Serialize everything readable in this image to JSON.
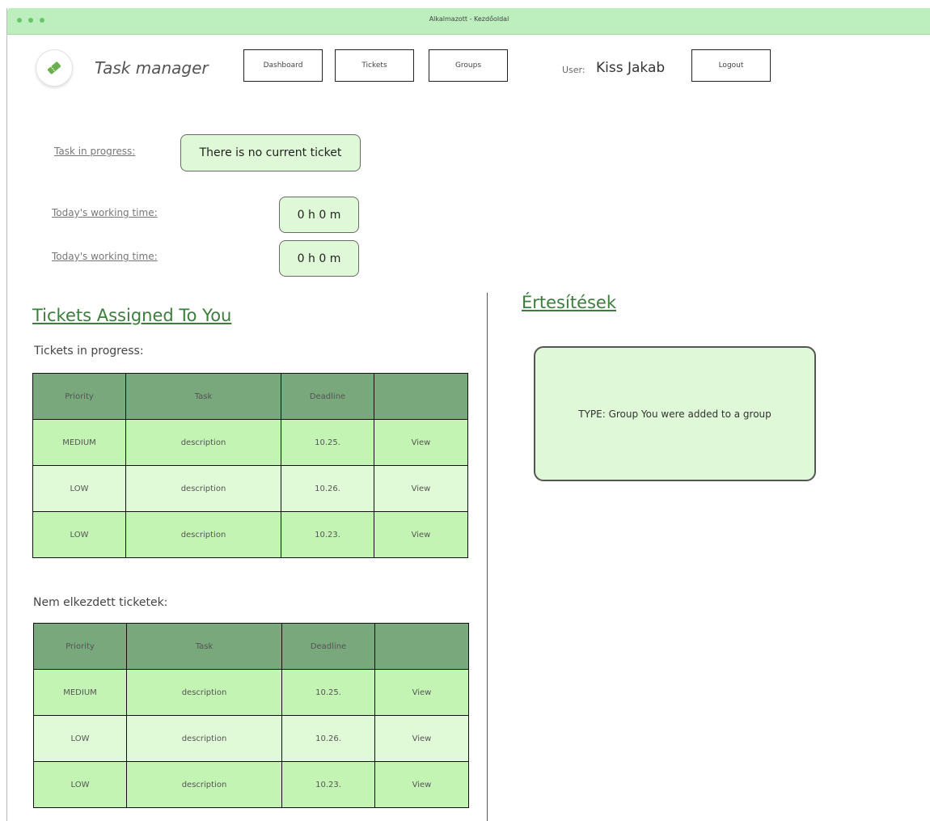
{
  "window": {
    "title": "Alkalmazott - Kezdőoldal"
  },
  "header": {
    "app_title": "Task manager",
    "nav": {
      "dashboard": "Dashboard",
      "tickets": "Tickets",
      "groups": "Groups"
    },
    "user_label": "User:",
    "user_name": "Kiss Jakab",
    "logout": "Logout"
  },
  "status": {
    "task_in_progress_label": "Task in progress:",
    "task_in_progress_value": "There is no current ticket",
    "working_time_1_label": "Today's working time:",
    "working_time_1_value": "0 h 0 m",
    "working_time_2_label": "Today's working time:",
    "working_time_2_value": "0 h 0 m"
  },
  "tickets_section": {
    "heading": "Tickets Assigned To You",
    "in_progress": {
      "label": "Tickets in progress:",
      "columns": [
        "Priority",
        "Task",
        "Deadline",
        ""
      ],
      "rows": [
        {
          "priority": "MEDIUM",
          "task": "description",
          "deadline": "10.25.",
          "action": "View"
        },
        {
          "priority": "LOW",
          "task": "description",
          "deadline": "10.26.",
          "action": "View"
        },
        {
          "priority": "LOW",
          "task": "description",
          "deadline": "10.23.",
          "action": "View"
        }
      ]
    },
    "not_started": {
      "label": "Nem elkezdett ticketek:",
      "columns": [
        "Priority",
        "Task",
        "Deadline",
        ""
      ],
      "rows": [
        {
          "priority": "MEDIUM",
          "task": "description",
          "deadline": "10.25.",
          "action": "View"
        },
        {
          "priority": "LOW",
          "task": "description",
          "deadline": "10.26.",
          "action": "View"
        },
        {
          "priority": "LOW",
          "task": "description",
          "deadline": "10.23.",
          "action": "View"
        }
      ]
    }
  },
  "notifications": {
    "heading": "Értesítések",
    "items": [
      {
        "text": "TYPE: Group You were added to a group"
      }
    ]
  },
  "colors": {
    "titlebar": "#bdeebd",
    "table_header": "#78a87b",
    "row_dark": "#c3f4b4",
    "row_light": "#e0f9d6",
    "heading": "#3b7d3b"
  }
}
